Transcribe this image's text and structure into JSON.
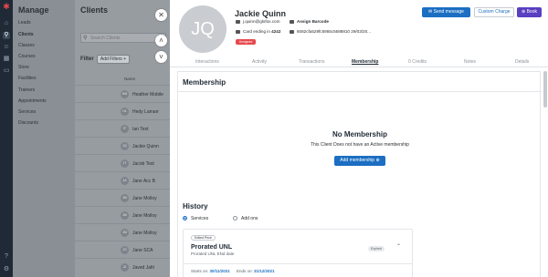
{
  "rail": {
    "icons": [
      "logo-icon",
      "home-icon",
      "search-icon",
      "users-icon",
      "calendar-icon",
      "card-icon",
      "help-icon",
      "settings-icon"
    ]
  },
  "manage": {
    "title": "Manage",
    "items": [
      "Leads",
      "Clients",
      "Classes",
      "Courses",
      "Store",
      "Facilities",
      "Trainers",
      "Appointments",
      "Services",
      "Discounts"
    ],
    "selected": "Clients"
  },
  "clients": {
    "title": "Clients",
    "search_placeholder": "Search Clients",
    "filter_label": "Filter",
    "add_filters": "Add Filters +",
    "column_name": "Name",
    "rows": [
      {
        "initials": "HM",
        "name": "Heather Mobile"
      },
      {
        "initials": "HL",
        "name": "Hedy Lamarr"
      },
      {
        "initials": "IT",
        "name": "Ian Test"
      },
      {
        "initials": "JQ",
        "name": "Jackie Quinn"
      },
      {
        "initials": "JT",
        "name": "Jacob Test"
      },
      {
        "initials": "JA",
        "name": "Jane Acc B"
      },
      {
        "initials": "JM",
        "name": "Jane Molloy"
      },
      {
        "initials": "JM",
        "name": "Jane Molloy"
      },
      {
        "initials": "JM",
        "name": "Jane Molloy"
      },
      {
        "initials": "JS",
        "name": "Jane SCA"
      },
      {
        "initials": "JJ",
        "name": "Javed Jafri"
      }
    ]
  },
  "profile": {
    "initials": "JQ",
    "name": "Jackie Quinn",
    "email": "j.quinn@glofox.com",
    "barcode": "Assign Barcode",
    "card_prefix": "Card ending in",
    "card_last4": "4242",
    "member_id": "6082cfa529fc5955c5588810",
    "joined": "29/03/20...",
    "badge": "Unsigned",
    "send_message": "Send message",
    "custom_charge": "Custom Charge",
    "book": "Book"
  },
  "tabs": [
    "Interactions",
    "Activity",
    "Transactions",
    "Membership",
    "0 Credits",
    "Notes",
    "Details"
  ],
  "selected_tab": "Membership",
  "membership": {
    "title": "Membership",
    "empty_title": "No Membership",
    "empty_sub": "This Client Does not have an Active membership",
    "add_button": "Add membership"
  },
  "history": {
    "title": "History",
    "options": [
      "Services",
      "Add ons"
    ],
    "selected": "Services",
    "card": {
      "tag": "Edited Price",
      "title": "Prorated UNL",
      "subtitle": "Prorated UNL ENd date",
      "status": "Expired",
      "starts_label": "Starts on:",
      "starts": "30/11/2021",
      "ends_label": "Ends on:",
      "ends": "31/12/2021"
    }
  },
  "colors": {
    "primary": "#1b6ec2",
    "book": "#5a3fc0",
    "danger": "#e5484d",
    "sidebar": "#1f2a36"
  }
}
